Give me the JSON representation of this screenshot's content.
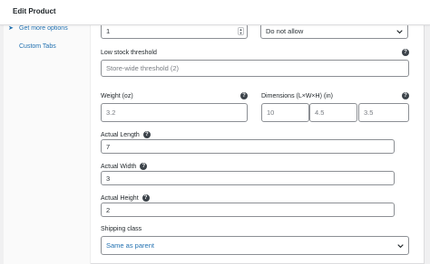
{
  "header": {
    "title": "Edit Product"
  },
  "sidebar": {
    "items": [
      {
        "label": "Get more options",
        "icon": "plugin-icon"
      },
      {
        "label": "Custom Tabs",
        "icon": "tabs-icon"
      }
    ]
  },
  "form": {
    "stock_qty": {
      "value": "1"
    },
    "backorders": {
      "selected": "Do not allow"
    },
    "low_stock": {
      "label": "Low stock threshold",
      "placeholder": "Store-wide threshold (2)"
    },
    "weight": {
      "label": "Weight (oz)",
      "placeholder": "3.2"
    },
    "dimensions": {
      "label": "Dimensions (L×W×H) (in)",
      "length_placeholder": "10",
      "width_placeholder": "4.5",
      "height_placeholder": "3.5"
    },
    "actual_length": {
      "label": "Actual Length",
      "value": "7"
    },
    "actual_width": {
      "label": "Actual Width",
      "value": "3"
    },
    "actual_height": {
      "label": "Actual Height",
      "value": "2"
    },
    "shipping_class": {
      "label": "Shipping class",
      "selected": "Same as parent"
    }
  },
  "colors": {
    "link": "#2271b1",
    "border": "#8c8f94",
    "help_icon": "#3c434a"
  }
}
